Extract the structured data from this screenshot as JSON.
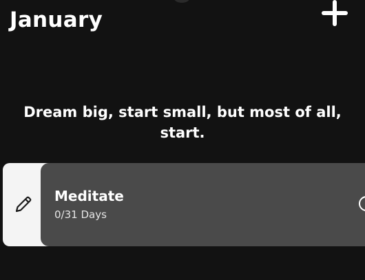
{
  "header": {
    "month": "January"
  },
  "quote": "Dream big, start small, but most of all, start.",
  "habits": [
    {
      "name": "Meditate",
      "progress": "0/31 Days"
    }
  ],
  "icons": {
    "add": "plus-icon",
    "edit": "pencil-icon",
    "complete": "circle-check-icon"
  },
  "colors": {
    "background": "#121212",
    "card": "#4a4a4a",
    "edit_panel": "#f4f4f4",
    "text": "#ffffff"
  }
}
